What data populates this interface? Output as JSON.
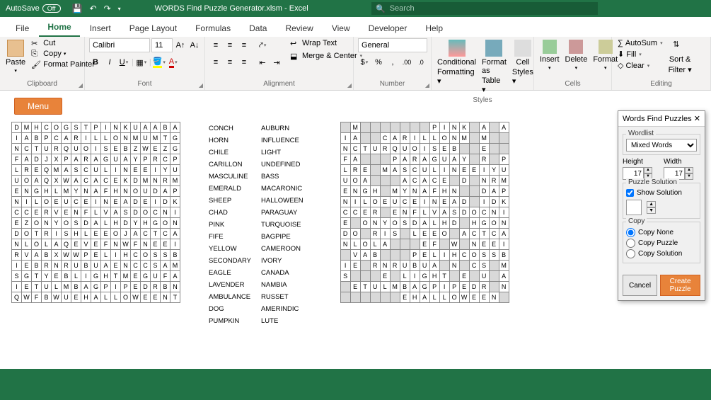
{
  "titlebar": {
    "autosave": "AutoSave",
    "off": "Off",
    "doc": "WORDS Find Puzzle Generator.xlsm  -  Excel",
    "search": "Search"
  },
  "tabs": [
    "File",
    "Home",
    "Insert",
    "Page Layout",
    "Formulas",
    "Data",
    "Review",
    "View",
    "Developer",
    "Help"
  ],
  "active_tab": 1,
  "ribbon": {
    "clipboard": {
      "paste": "Paste",
      "cut": "Cut",
      "copy": "Copy",
      "fp": "Format Painter",
      "label": "Clipboard"
    },
    "font": {
      "name": "Calibri",
      "size": "11",
      "label": "Font"
    },
    "align": {
      "wrap": "Wrap Text",
      "merge": "Merge & Center",
      "label": "Alignment"
    },
    "number": {
      "fmt": "General",
      "label": "Number"
    },
    "styles": {
      "cf": "Conditional",
      "cf2": "Formatting",
      "fat": "Format as",
      "fat2": "Table",
      "cs": "Cell",
      "cs2": "Styles",
      "label": "Styles"
    },
    "cells": {
      "ins": "Insert",
      "del": "Delete",
      "fmt": "Format",
      "label": "Cells"
    },
    "editing": {
      "as": "AutoSum",
      "fill": "Fill",
      "clr": "Clear",
      "sf": "Sort &",
      "sf2": "Filter",
      "label": "Editing"
    }
  },
  "menu_btn": "Menu",
  "grid1": [
    [
      "D",
      "M",
      "H",
      "C",
      "O",
      "G",
      "S",
      "T",
      "P",
      "I",
      "N",
      "K",
      "U",
      "A",
      "A",
      "B",
      "A"
    ],
    [
      "I",
      "A",
      "B",
      "P",
      "C",
      "A",
      "R",
      "I",
      "L",
      "L",
      "O",
      "N",
      "M",
      "U",
      "M",
      "T",
      "G"
    ],
    [
      "N",
      "C",
      "T",
      "U",
      "R",
      "Q",
      "U",
      "O",
      "I",
      "S",
      "E",
      "B",
      "Z",
      "W",
      "E",
      "Z",
      "G"
    ],
    [
      "F",
      "A",
      "D",
      "J",
      "X",
      "P",
      "A",
      "R",
      "A",
      "G",
      "U",
      "A",
      "Y",
      "P",
      "R",
      "C",
      "P"
    ],
    [
      "L",
      "R",
      "E",
      "Q",
      "M",
      "A",
      "S",
      "C",
      "U",
      "L",
      "I",
      "N",
      "E",
      "E",
      "I",
      "Y",
      "U"
    ],
    [
      "U",
      "O",
      "A",
      "Q",
      "X",
      "W",
      "A",
      "C",
      "A",
      "C",
      "E",
      "K",
      "D",
      "M",
      "N",
      "R",
      "M"
    ],
    [
      "E",
      "N",
      "G",
      "H",
      "L",
      "M",
      "Y",
      "N",
      "A",
      "F",
      "H",
      "N",
      "O",
      "U",
      "D",
      "A",
      "P"
    ],
    [
      "N",
      "I",
      "L",
      "O",
      "E",
      "U",
      "C",
      "E",
      "I",
      "N",
      "E",
      "A",
      "D",
      "E",
      "I",
      "D",
      "K"
    ],
    [
      "C",
      "C",
      "E",
      "R",
      "V",
      "E",
      "N",
      "F",
      "L",
      "V",
      "A",
      "S",
      "D",
      "O",
      "C",
      "N",
      "I"
    ],
    [
      "E",
      "Z",
      "O",
      "N",
      "Y",
      "O",
      "S",
      "D",
      "A",
      "L",
      "H",
      "D",
      "Y",
      "H",
      "G",
      "O",
      "N"
    ],
    [
      "D",
      "O",
      "T",
      "R",
      "I",
      "S",
      "H",
      "L",
      "E",
      "E",
      "O",
      "J",
      "A",
      "C",
      "T",
      "C",
      "A"
    ],
    [
      "N",
      "L",
      "O",
      "L",
      "A",
      "Q",
      "E",
      "V",
      "E",
      "F",
      "N",
      "W",
      "F",
      "N",
      "E",
      "E",
      "I"
    ],
    [
      "R",
      "V",
      "A",
      "B",
      "X",
      "W",
      "W",
      "P",
      "E",
      "L",
      "I",
      "H",
      "C",
      "O",
      "S",
      "S",
      "B"
    ],
    [
      "I",
      "E",
      "B",
      "R",
      "N",
      "R",
      "U",
      "B",
      "U",
      "A",
      "E",
      "N",
      "C",
      "C",
      "S",
      "A",
      "M"
    ],
    [
      "S",
      "G",
      "T",
      "Y",
      "E",
      "B",
      "L",
      "I",
      "G",
      "H",
      "T",
      "M",
      "E",
      "G",
      "U",
      "F",
      "A"
    ],
    [
      "I",
      "E",
      "T",
      "U",
      "L",
      "M",
      "B",
      "A",
      "G",
      "P",
      "I",
      "P",
      "E",
      "D",
      "R",
      "B",
      "N"
    ],
    [
      "Q",
      "W",
      "F",
      "B",
      "W",
      "U",
      "E",
      "H",
      "A",
      "L",
      "L",
      "O",
      "W",
      "E",
      "E",
      "N",
      "T"
    ]
  ],
  "words": [
    [
      "CONCH",
      "AUBURN"
    ],
    [
      "HORN",
      "INFLUENCE"
    ],
    [
      "CHILE",
      "LIGHT"
    ],
    [
      "CARILLON",
      "UNDEFINED"
    ],
    [
      "MASCULINE",
      "BASS"
    ],
    [
      "EMERALD",
      "MACARONIC"
    ],
    [
      "SHEEP",
      "HALLOWEEN"
    ],
    [
      "CHAD",
      "PARAGUAY"
    ],
    [
      "PINK",
      "TURQUOISE"
    ],
    [
      "FIFE",
      "BAGPIPE"
    ],
    [
      "YELLOW",
      "CAMEROON"
    ],
    [
      "SECONDARY",
      "IVORY"
    ],
    [
      "EAGLE",
      "CANADA"
    ],
    [
      "LAVENDER",
      "NAMBIA"
    ],
    [
      "AMBULANCE",
      "RUSSET"
    ],
    [
      "DOG",
      "AMERINDIC"
    ],
    [
      "PUMPKIN",
      "LUTE"
    ]
  ],
  "grid2": [
    [
      "",
      "M",
      "",
      "",
      "",
      "",
      "",
      "",
      "",
      "P",
      "I",
      "N",
      "K",
      "",
      "A",
      "",
      "A"
    ],
    [
      "I",
      "A",
      "",
      "",
      "C",
      "A",
      "R",
      "I",
      "L",
      "L",
      "O",
      "N",
      "M",
      "",
      "M",
      "",
      ""
    ],
    [
      "N",
      "C",
      "T",
      "U",
      "R",
      "Q",
      "U",
      "O",
      "I",
      "S",
      "E",
      "B",
      "",
      "",
      "E",
      "",
      ""
    ],
    [
      "F",
      "A",
      "",
      "",
      "",
      "P",
      "A",
      "R",
      "A",
      "G",
      "U",
      "A",
      "Y",
      "",
      "R",
      "",
      "P"
    ],
    [
      "L",
      "R",
      "E",
      "",
      "M",
      "A",
      "S",
      "C",
      "U",
      "L",
      "I",
      "N",
      "E",
      "E",
      "I",
      "Y",
      "U"
    ],
    [
      "U",
      "O",
      "A",
      "",
      "",
      "",
      "A",
      "C",
      "A",
      "C",
      "E",
      "",
      "D",
      "",
      "N",
      "R",
      "M"
    ],
    [
      "E",
      "N",
      "G",
      "H",
      "",
      "M",
      "Y",
      "N",
      "A",
      "F",
      "H",
      "N",
      "",
      "",
      "D",
      "A",
      "P"
    ],
    [
      "N",
      "I",
      "L",
      "O",
      "E",
      "U",
      "C",
      "E",
      "I",
      "N",
      "E",
      "A",
      "D",
      "",
      "I",
      "D",
      "K"
    ],
    [
      "C",
      "C",
      "E",
      "R",
      "",
      "E",
      "N",
      "F",
      "L",
      "V",
      "A",
      "S",
      "D",
      "O",
      "C",
      "N",
      "I"
    ],
    [
      "E",
      "",
      "O",
      "N",
      "Y",
      "O",
      "S",
      "D",
      "A",
      "L",
      "H",
      "D",
      "",
      "H",
      "G",
      "O",
      "N"
    ],
    [
      "D",
      "O",
      "",
      "R",
      "I",
      "S",
      "",
      "L",
      "E",
      "E",
      "O",
      "",
      "A",
      "C",
      "T",
      "C",
      "A"
    ],
    [
      "N",
      "L",
      "O",
      "L",
      "A",
      "",
      "",
      "",
      "E",
      "F",
      "",
      "W",
      "",
      "N",
      "E",
      "E",
      "I"
    ],
    [
      "",
      "V",
      "A",
      "B",
      "",
      "",
      "",
      "P",
      "E",
      "L",
      "I",
      "H",
      "C",
      "O",
      "S",
      "S",
      "B"
    ],
    [
      "I",
      "E",
      "",
      "R",
      "N",
      "R",
      "U",
      "B",
      "U",
      "A",
      "",
      "N",
      "",
      "C",
      "S",
      "",
      "M"
    ],
    [
      "S",
      "",
      "",
      "",
      "E",
      "",
      "L",
      "I",
      "G",
      "H",
      "T",
      "",
      "E",
      "",
      "U",
      "",
      "A"
    ],
    [
      "",
      "E",
      "T",
      "U",
      "L",
      "M",
      "B",
      "A",
      "G",
      "P",
      "I",
      "P",
      "E",
      "D",
      "R",
      "",
      "N"
    ],
    [
      "",
      "",
      "",
      "",
      "",
      "",
      "E",
      "H",
      "A",
      "L",
      "L",
      "O",
      "W",
      "E",
      "E",
      "N",
      ""
    ]
  ],
  "dialog": {
    "title": "Words Find Puzzles",
    "wordlist_label": "Wordlist",
    "wordlist_val": "Mixed Words",
    "height": "Height",
    "height_val": "17",
    "width": "Width",
    "width_val": "17",
    "ps": "Puzzle Solution",
    "show": "Show Solution",
    "copy": "Copy",
    "cn": "Copy None",
    "cp": "Copy Puzzle",
    "cs": "Copy Solution",
    "cancel": "Cancel",
    "create": "Create Puzzle"
  }
}
